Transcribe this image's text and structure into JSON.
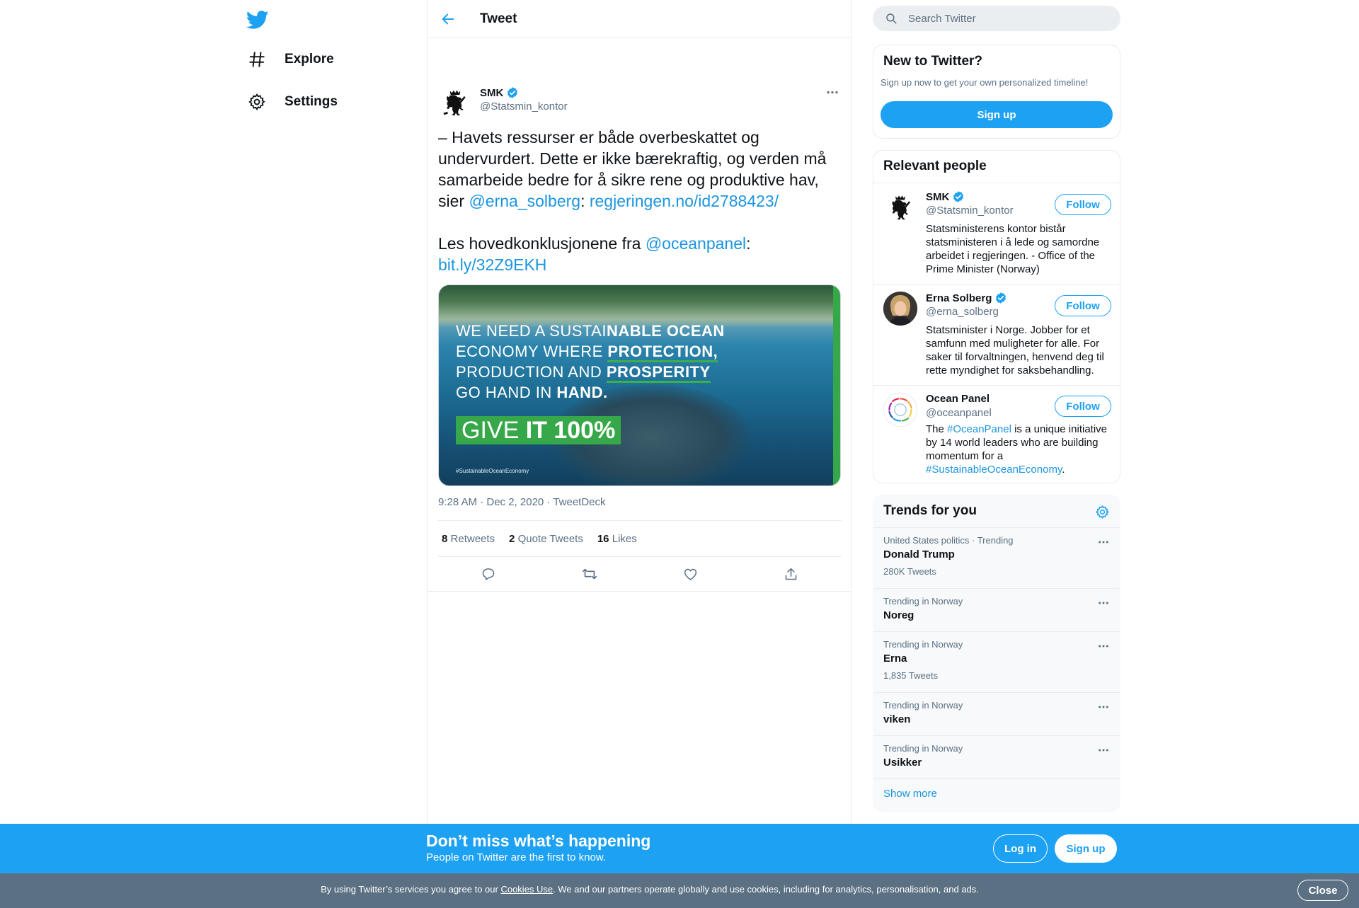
{
  "nav": {
    "explore_label": "Explore",
    "settings_label": "Settings"
  },
  "header": {
    "title": "Tweet"
  },
  "tweet": {
    "author_name": "SMK",
    "author_handle": "@Statsmin_kontor",
    "text_part1": "– Havets ressurser er både overbeskattet og undervurdert. Dette er ikke bærekraftig, og verden må samarbeide bedre for å sikre rene og produktive hav, sier ",
    "mention1": "@erna_solberg",
    "sep1": ": ",
    "link1": "regjeringen.no/id2788423/",
    "text_part2": "Les hovedkonklusjonene fra ",
    "mention2": "@oceanpanel",
    "sep2": ":",
    "link2": "bit.ly/32Z9EKH",
    "media": {
      "line1_light": "WE NEED A SUSTAI",
      "line1_bold": "NABLE OCEAN",
      "line2_light": "ECONOMY WHERE ",
      "line2_bold": "PROTECTION,",
      "line3_light": "PRODUCTION AND ",
      "line3_bold": "PROSPERITY",
      "line4_light": "GO HAND IN ",
      "line4_bold": "HAND.",
      "give_light": "GIVE ",
      "give_bold": "IT 100%",
      "hashtag": "#SustainableOceanEconomy"
    },
    "time": "9:28 AM · Dec 2, 2020",
    "meta_sep": " · ",
    "source": "TweetDeck",
    "retweets_count": "8",
    "retweets_label": "Retweets",
    "quotes_count": "2",
    "quotes_label": "Quote Tweets",
    "likes_count": "16",
    "likes_label": "Likes"
  },
  "search": {
    "placeholder": "Search Twitter"
  },
  "new_to_twitter": {
    "title": "New to Twitter?",
    "subtitle": "Sign up now to get your own personalized timeline!",
    "button": "Sign up"
  },
  "relevant": {
    "title": "Relevant people",
    "follow_label": "Follow",
    "people": [
      {
        "name": "SMK",
        "handle": "@Statsmin_kontor",
        "bio": "Statsministerens kontor bistår statsministeren i å lede og samordne arbeidet i regjeringen. - Office of the Prime Minister (Norway)"
      },
      {
        "name": "Erna Solberg",
        "handle": "@erna_solberg",
        "bio": "Statsminister i Norge. Jobber for et samfunn med muligheter for alle. For saker til forvaltningen, henvend deg til rette myndighet for saksbehandling."
      },
      {
        "name": "Ocean Panel",
        "handle": "@oceanpanel",
        "bio_pre": "The ",
        "bio_tag1": "#OceanPanel",
        "bio_mid": " is a unique initiative by 14 world leaders who are building momentum for a ",
        "bio_tag2": "#SustainableOceanEconomy",
        "bio_post": "."
      }
    ]
  },
  "trends": {
    "title": "Trends for you",
    "items": [
      {
        "context": "United States politics · Trending",
        "name": "Donald Trump",
        "count": "280K Tweets"
      },
      {
        "context": "Trending in Norway",
        "name": "Noreg"
      },
      {
        "context": "Trending in Norway",
        "name": "Erna",
        "count": "1,835 Tweets"
      },
      {
        "context": "Trending in Norway",
        "name": "viken"
      },
      {
        "context": "Trending in Norway",
        "name": "Usikker"
      }
    ],
    "show_more": "Show more"
  },
  "signup_bar": {
    "title": "Don’t miss what’s happening",
    "subtitle": "People on Twitter are the first to know.",
    "login": "Log in",
    "signup": "Sign up"
  },
  "cookie_bar": {
    "text_pre": "By using Twitter’s services you agree to our ",
    "link": "Cookies Use",
    "text_post": ". We and our partners operate globally and use cookies, including for analytics, personalisation, and ads.",
    "close": "Close"
  },
  "colors": {
    "brand": "#1da1f2",
    "link": "#1b95e0",
    "secondary_text": "#5b7083",
    "cookie_bar": "#5b7083",
    "media_green": "#37a84a"
  },
  "icons": {
    "logo": "twitter-bird-icon",
    "explore": "hashtag-icon",
    "settings": "gear-icon",
    "back": "arrow-left-icon",
    "more": "more-dots-icon",
    "verified": "verified-badge-icon",
    "reply": "reply-icon",
    "retweet": "retweet-icon",
    "like": "heart-icon",
    "share": "share-icon",
    "search": "search-icon"
  }
}
